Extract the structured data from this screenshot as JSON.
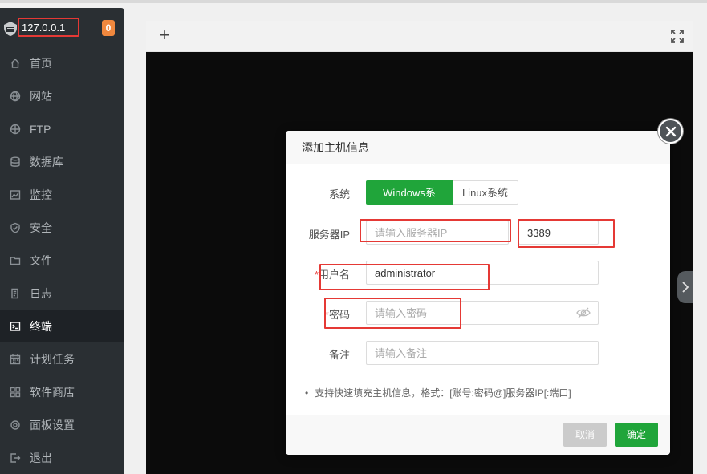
{
  "header": {
    "ip": "127.0.0.1",
    "badge_count": "0"
  },
  "sidebar": {
    "items": [
      {
        "label": "首页",
        "icon": "home-icon"
      },
      {
        "label": "网站",
        "icon": "globe-icon"
      },
      {
        "label": "FTP",
        "icon": "ftp-globe-icon"
      },
      {
        "label": "数据库",
        "icon": "database-icon"
      },
      {
        "label": "监控",
        "icon": "monitor-icon"
      },
      {
        "label": "安全",
        "icon": "shield-icon"
      },
      {
        "label": "文件",
        "icon": "folder-icon"
      },
      {
        "label": "日志",
        "icon": "log-icon"
      },
      {
        "label": "终端",
        "icon": "terminal-icon",
        "active": true
      },
      {
        "label": "计划任务",
        "icon": "calendar-icon"
      },
      {
        "label": "软件商店",
        "icon": "apps-icon"
      },
      {
        "label": "面板设置",
        "icon": "gear-icon"
      },
      {
        "label": "退出",
        "icon": "logout-icon"
      }
    ]
  },
  "toolbar": {
    "add_symbol": "+"
  },
  "dialog": {
    "title": "添加主机信息",
    "system_label": "系统",
    "system_options": [
      "Windows系统",
      "Linux系统"
    ],
    "system_selected": "Windows系统",
    "server_ip_label": "服务器IP",
    "server_ip_placeholder": "请输入服务器IP",
    "port_value": "3389",
    "username_label": "用户名",
    "username_value": "administrator",
    "password_label": "密码",
    "password_placeholder": "请输入密码",
    "note_label": "备注",
    "note_placeholder": "请输入备注",
    "tip": "支持快速填充主机信息，格式：[账号:密码@]服务器IP[:端口]",
    "required_mark": "*",
    "cancel_label": "取消",
    "confirm_label": "确定"
  },
  "colors": {
    "accent": "#20a53a",
    "sidebar_bg": "#2a2f33",
    "highlight_red": "#e53935",
    "badge": "#f0883e"
  }
}
